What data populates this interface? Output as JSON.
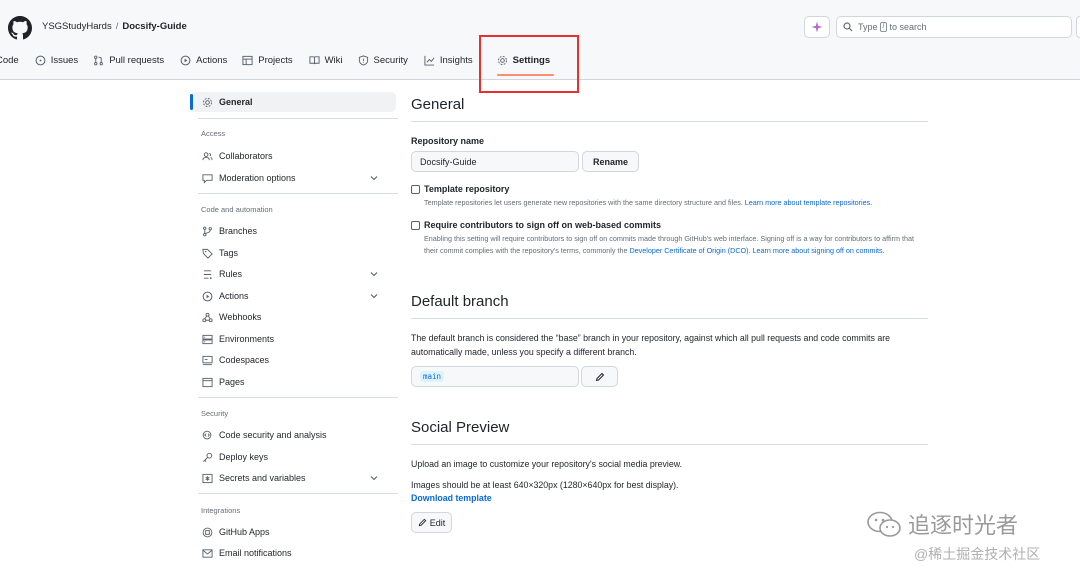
{
  "header": {
    "owner": "YSGStudyHards",
    "separator": "/",
    "repo": "Docsify-Guide",
    "search_text_before": "Type",
    "search_kbd": "/",
    "search_text_after": "to search"
  },
  "tabs": [
    {
      "label": "Code",
      "icon": "code-icon"
    },
    {
      "label": "Issues",
      "icon": "issue-icon"
    },
    {
      "label": "Pull requests",
      "icon": "pull-request-icon"
    },
    {
      "label": "Actions",
      "icon": "play-icon"
    },
    {
      "label": "Projects",
      "icon": "table-icon"
    },
    {
      "label": "Wiki",
      "icon": "book-icon"
    },
    {
      "label": "Security",
      "icon": "shield-icon"
    },
    {
      "label": "Insights",
      "icon": "graph-icon"
    },
    {
      "label": "Settings",
      "icon": "gear-icon",
      "active": true
    }
  ],
  "sidebar": {
    "general": "General",
    "access_heading": "Access",
    "collaborators": "Collaborators",
    "moderation": "Moderation options",
    "code_heading": "Code and automation",
    "branches": "Branches",
    "tags": "Tags",
    "rules": "Rules",
    "actions": "Actions",
    "webhooks": "Webhooks",
    "environments": "Environments",
    "codespaces": "Codespaces",
    "pages": "Pages",
    "security_heading": "Security",
    "code_security": "Code security and analysis",
    "deploy_keys": "Deploy keys",
    "secrets": "Secrets and variables",
    "integrations_heading": "Integrations",
    "github_apps": "GitHub Apps",
    "email_notifications": "Email notifications"
  },
  "general": {
    "title": "General",
    "repo_name_label": "Repository name",
    "repo_name_value": "Docsify-Guide",
    "rename_button": "Rename",
    "template_label": "Template repository",
    "template_note": "Template repositories let users generate new repositories with the same directory structure and files.",
    "template_link": "Learn more about template repositories.",
    "signoff_label": "Require contributors to sign off on web-based commits",
    "signoff_note_1": "Enabling this setting will require contributors to sign off on commits made through GitHub's web interface. Signing off is a way for contributors to affirm that their commit complies with the repository's terms, commonly the",
    "signoff_link_1": "Developer Certificate of Origin (DCO).",
    "signoff_link_2": "Learn more about signing off on commits."
  },
  "default_branch": {
    "title": "Default branch",
    "description": "The default branch is considered the “base” branch in your repository, against which all pull requests and code commits are automatically made, unless you specify a different branch.",
    "branch": "main"
  },
  "social_preview": {
    "title": "Social Preview",
    "upload_text": "Upload an image to customize your repository's social media preview.",
    "size_text": "Images should be at least 640×320px (1280×640px for best display).",
    "download_link": "Download template",
    "edit_button": "Edit"
  },
  "watermark": {
    "line1": "追逐时光者",
    "line2": "@稀土掘金技术社区"
  }
}
